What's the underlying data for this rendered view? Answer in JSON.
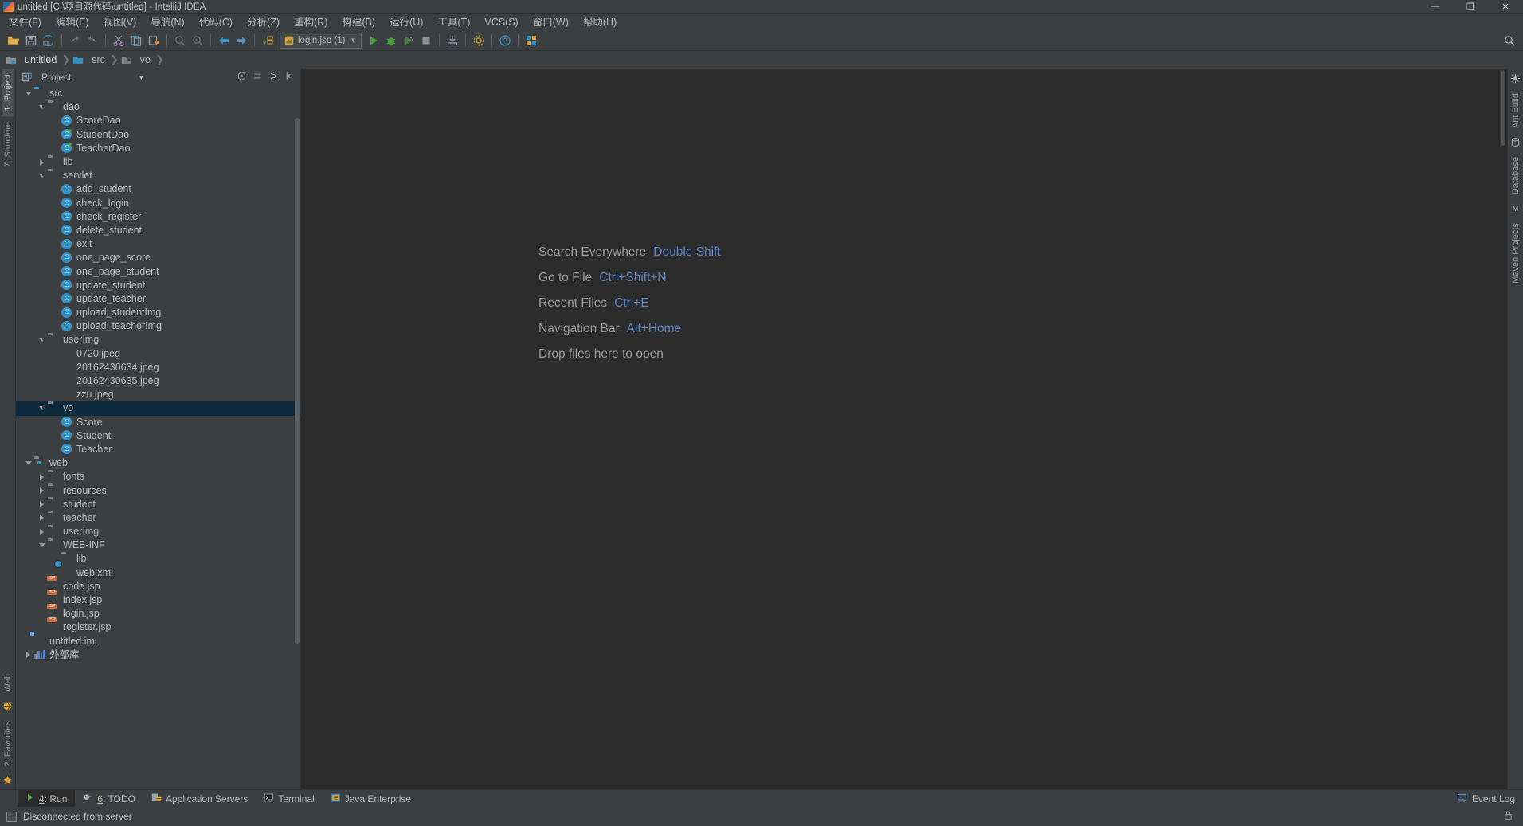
{
  "window": {
    "title": "untitled [C:\\项目源代码\\untitled] - IntelliJ IDEA",
    "minimize": "—",
    "maximize": "❐",
    "close": "✕"
  },
  "menubar": {
    "items": [
      "文件(F)",
      "编辑(E)",
      "视图(V)",
      "导航(N)",
      "代码(C)",
      "分析(Z)",
      "重构(R)",
      "构建(B)",
      "运行(U)",
      "工具(T)",
      "VCS(S)",
      "窗口(W)",
      "帮助(H)"
    ]
  },
  "toolbar": {
    "run_config": "login.jsp (1)",
    "icons": [
      "open-folder-icon",
      "save-all-icon",
      "sync-icon",
      "undo-icon",
      "redo-icon",
      "cut-icon",
      "copy-icon",
      "paste-icon",
      "find-icon",
      "replace-icon",
      "back-icon",
      "forward-icon",
      "compile-icon"
    ],
    "right_icons": [
      "search-everywhere-icon"
    ]
  },
  "breadcrumb": {
    "items": [
      {
        "label": "untitled",
        "icon": "module-icon"
      },
      {
        "label": "src",
        "icon": "source-folder-icon"
      },
      {
        "label": "vo",
        "icon": "package-folder-icon"
      }
    ],
    "separator": "❯"
  },
  "left_strip": {
    "tabs": [
      {
        "label": "1: Project",
        "active": true
      },
      {
        "label": "7: Structure",
        "active": false
      }
    ],
    "bottom_tabs": [
      {
        "label": "Web",
        "active": false
      },
      {
        "label": "2: Favorites",
        "active": false
      }
    ]
  },
  "right_strip": {
    "tabs": [
      "Ant Build",
      "Database",
      "Maven Projects"
    ]
  },
  "project_panel": {
    "title": "Project",
    "header_icons": [
      "target-icon",
      "collapse-all-icon",
      "settings-gear-icon",
      "hide-icon"
    ],
    "tree": [
      {
        "depth": 1,
        "twisty": "open",
        "icon": "folder-src",
        "label": "src"
      },
      {
        "depth": 2,
        "twisty": "open",
        "icon": "folder-pkg",
        "label": "dao"
      },
      {
        "depth": 3,
        "twisty": "none",
        "icon": "class",
        "label": "ScoreDao"
      },
      {
        "depth": 3,
        "twisty": "none",
        "icon": "class-run",
        "label": "StudentDao"
      },
      {
        "depth": 3,
        "twisty": "none",
        "icon": "class-run",
        "label": "TeacherDao"
      },
      {
        "depth": 2,
        "twisty": "closed",
        "icon": "folder-pkg",
        "label": "lib"
      },
      {
        "depth": 2,
        "twisty": "open",
        "icon": "folder-pkg",
        "label": "servlet"
      },
      {
        "depth": 3,
        "twisty": "none",
        "icon": "class",
        "label": "add_student"
      },
      {
        "depth": 3,
        "twisty": "none",
        "icon": "class",
        "label": "check_login"
      },
      {
        "depth": 3,
        "twisty": "none",
        "icon": "class",
        "label": "check_register"
      },
      {
        "depth": 3,
        "twisty": "none",
        "icon": "class",
        "label": "delete_student"
      },
      {
        "depth": 3,
        "twisty": "none",
        "icon": "class",
        "label": "exit"
      },
      {
        "depth": 3,
        "twisty": "none",
        "icon": "class",
        "label": "one_page_score"
      },
      {
        "depth": 3,
        "twisty": "none",
        "icon": "class",
        "label": "one_page_student"
      },
      {
        "depth": 3,
        "twisty": "none",
        "icon": "class",
        "label": "update_student"
      },
      {
        "depth": 3,
        "twisty": "none",
        "icon": "class",
        "label": "update_teacher"
      },
      {
        "depth": 3,
        "twisty": "none",
        "icon": "class",
        "label": "upload_studentImg"
      },
      {
        "depth": 3,
        "twisty": "none",
        "icon": "class",
        "label": "upload_teacherImg"
      },
      {
        "depth": 2,
        "twisty": "open",
        "icon": "folder-pkg",
        "label": "userImg"
      },
      {
        "depth": 3,
        "twisty": "none",
        "icon": "image",
        "label": "0720.jpeg"
      },
      {
        "depth": 3,
        "twisty": "none",
        "icon": "image",
        "label": "20162430634.jpeg"
      },
      {
        "depth": 3,
        "twisty": "none",
        "icon": "image",
        "label": "20162430635.jpeg"
      },
      {
        "depth": 3,
        "twisty": "none",
        "icon": "image",
        "label": "zzu.jpeg"
      },
      {
        "depth": 2,
        "twisty": "open",
        "icon": "folder-pkg",
        "label": "vo",
        "selected": true
      },
      {
        "depth": 3,
        "twisty": "none",
        "icon": "class",
        "label": "Score"
      },
      {
        "depth": 3,
        "twisty": "none",
        "icon": "class",
        "label": "Student"
      },
      {
        "depth": 3,
        "twisty": "none",
        "icon": "class",
        "label": "Teacher"
      },
      {
        "depth": 1,
        "twisty": "open",
        "icon": "folder-web",
        "label": "web"
      },
      {
        "depth": 2,
        "twisty": "closed",
        "icon": "folder",
        "label": "fonts"
      },
      {
        "depth": 2,
        "twisty": "closed",
        "icon": "folder",
        "label": "resources"
      },
      {
        "depth": 2,
        "twisty": "closed",
        "icon": "folder",
        "label": "student"
      },
      {
        "depth": 2,
        "twisty": "closed",
        "icon": "folder",
        "label": "teacher"
      },
      {
        "depth": 2,
        "twisty": "closed",
        "icon": "folder",
        "label": "userImg"
      },
      {
        "depth": 2,
        "twisty": "open",
        "icon": "folder",
        "label": "WEB-INF"
      },
      {
        "depth": 3,
        "twisty": "none",
        "icon": "folder",
        "label": "lib"
      },
      {
        "depth": 3,
        "twisty": "none",
        "icon": "xml",
        "label": "web.xml"
      },
      {
        "depth": 2,
        "twisty": "none",
        "icon": "jsp",
        "label": "code.jsp"
      },
      {
        "depth": 2,
        "twisty": "none",
        "icon": "jsp",
        "label": "index.jsp"
      },
      {
        "depth": 2,
        "twisty": "none",
        "icon": "jsp",
        "label": "login.jsp"
      },
      {
        "depth": 2,
        "twisty": "none",
        "icon": "jsp",
        "label": "register.jsp"
      },
      {
        "depth": 1,
        "twisty": "none",
        "icon": "iml",
        "label": "untitled.iml"
      },
      {
        "depth": 1,
        "twisty": "closed",
        "icon": "library",
        "label": "外部库"
      }
    ]
  },
  "editor": {
    "tips": [
      {
        "label": "Search Everywhere",
        "key": "Double Shift"
      },
      {
        "label": "Go to File",
        "key": "Ctrl+Shift+N"
      },
      {
        "label": "Recent Files",
        "key": "Ctrl+E"
      },
      {
        "label": "Navigation Bar",
        "key": "Alt+Home"
      },
      {
        "label": "Drop files here to open",
        "key": ""
      }
    ]
  },
  "bottom_tabs": {
    "items": [
      {
        "num": "4",
        "label": "Run",
        "icon": "run-icon",
        "active": true
      },
      {
        "num": "6",
        "label": "TODO",
        "icon": "todo-icon",
        "active": false
      },
      {
        "num": "",
        "label": "Application Servers",
        "icon": "app-servers-icon",
        "active": false
      },
      {
        "num": "",
        "label": "Terminal",
        "icon": "terminal-icon",
        "active": false
      },
      {
        "num": "",
        "label": "Java Enterprise",
        "icon": "java-enterprise-icon",
        "active": false
      }
    ],
    "right": {
      "label": "Event Log",
      "icon": "event-log-icon"
    }
  },
  "statusbar": {
    "message": "Disconnected from server",
    "right_icons": [
      "lock-icon"
    ]
  },
  "colors": {
    "accent_blue": "#3592c4",
    "key_blue": "#5a86c5",
    "selection": "#0d293e",
    "editor_bg": "#2b2b2b",
    "chrome_bg": "#3c3f41"
  }
}
